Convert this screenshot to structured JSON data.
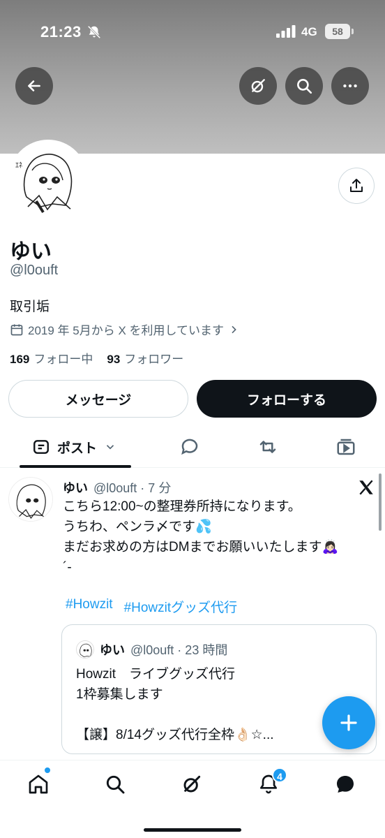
{
  "status_bar": {
    "time": "21:23",
    "network": "4G",
    "battery": "58"
  },
  "profile": {
    "name": "ゆい",
    "handle": "@l0ouft",
    "bio": "取引垢",
    "joined": "2019 年 5月から X を利用しています",
    "following_count": "169",
    "following_label": "フォロー中",
    "followers_count": "93",
    "followers_label": "フォロワー"
  },
  "actions": {
    "message_label": "メッセージ",
    "follow_label": "フォローする"
  },
  "tabs": {
    "posts_label": "ポスト"
  },
  "post": {
    "author": "ゆい",
    "meta": "@l0ouft · 7 分",
    "lines": [
      "こちら12:00~の整理券所持になります。",
      "うちわ、ペンラ〆です💦",
      "まだお求めの方はDMまでお願いいたします🙇🏻‍♀️",
      "´-"
    ],
    "hashtags": [
      "#Howzit",
      "#Howzitグッズ代行"
    ],
    "quote": {
      "author": "ゆい",
      "meta": "@l0ouft · 23 時間",
      "lines": [
        "Howzit　ライブグッズ代行",
        "1枠募集します",
        "",
        "【譲】8/14グッズ代行全枠👌🏻☆..."
      ]
    }
  },
  "bottom_nav": {
    "notifications_badge": "4"
  },
  "colors": {
    "accent": "#1d9bf0",
    "text": "#0f1419",
    "muted": "#536471"
  }
}
